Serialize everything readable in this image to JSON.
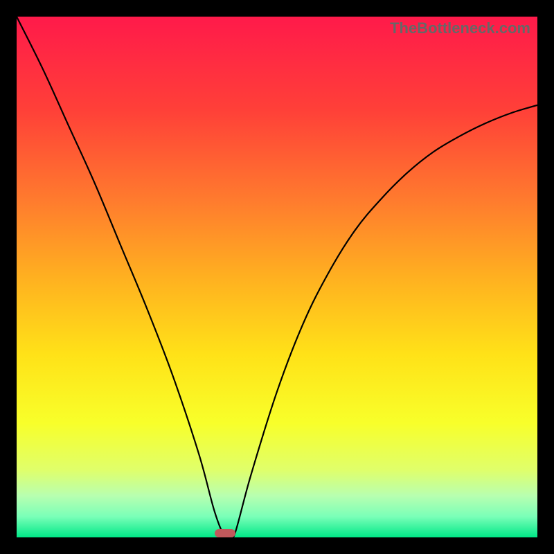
{
  "watermark": "TheBottleneck.com",
  "chart_data": {
    "type": "line",
    "title": "",
    "xlabel": "",
    "ylabel": "",
    "xlim": [
      0,
      100
    ],
    "ylim": [
      0,
      100
    ],
    "gradient_stops": [
      {
        "offset": 0,
        "color": "#ff1a4a"
      },
      {
        "offset": 18,
        "color": "#ff4038"
      },
      {
        "offset": 35,
        "color": "#ff7a2e"
      },
      {
        "offset": 50,
        "color": "#ffb020"
      },
      {
        "offset": 65,
        "color": "#ffe218"
      },
      {
        "offset": 78,
        "color": "#f8ff2a"
      },
      {
        "offset": 87,
        "color": "#e0ff6a"
      },
      {
        "offset": 92,
        "color": "#b8ffb0"
      },
      {
        "offset": 96,
        "color": "#7affb8"
      },
      {
        "offset": 100,
        "color": "#00e887"
      }
    ],
    "series": [
      {
        "name": "bottleneck-curve",
        "x": [
          0,
          5,
          10,
          15,
          20,
          25,
          30,
          35,
          38,
          40,
          41,
          42,
          45,
          50,
          55,
          60,
          65,
          70,
          75,
          80,
          85,
          90,
          95,
          100
        ],
        "y": [
          100,
          90,
          79,
          68,
          56,
          44,
          31,
          16,
          5,
          0,
          0,
          1,
          12,
          28,
          41,
          51,
          59,
          65,
          70,
          74,
          77,
          79.5,
          81.5,
          83
        ]
      }
    ],
    "indicator": {
      "x_start": 38,
      "x_end": 42,
      "y": 0,
      "color": "#c1595c"
    }
  }
}
